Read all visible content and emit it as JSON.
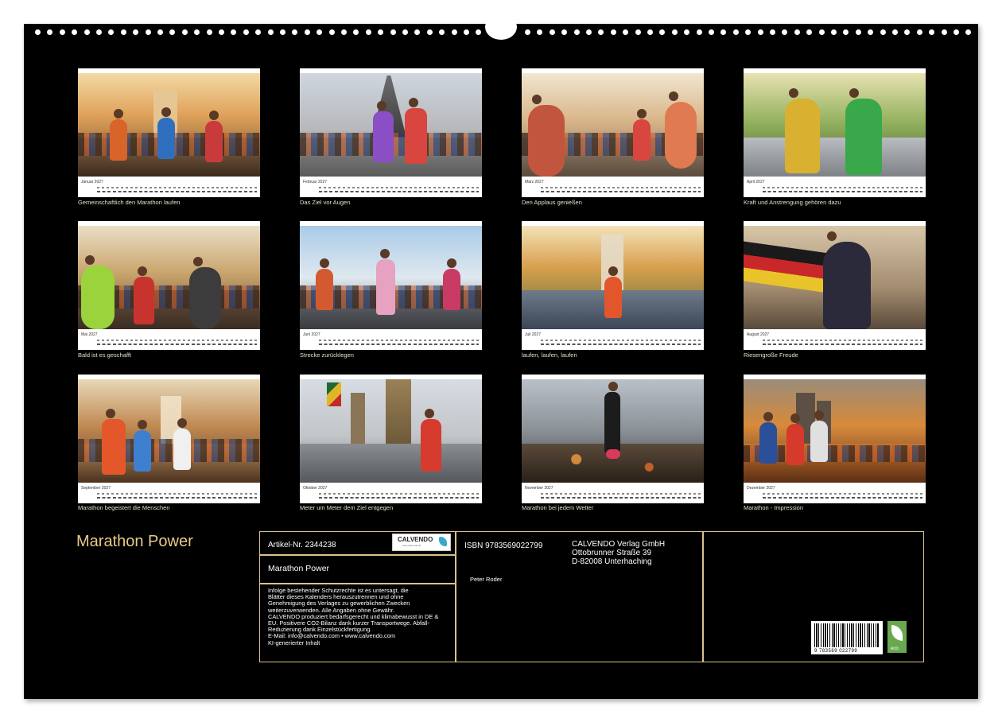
{
  "title": "Marathon Power",
  "months": [
    {
      "label": "Januar 2027",
      "caption": "Gemeinschaftlich den Marathon laufen"
    },
    {
      "label": "Februar 2027",
      "caption": "Das Ziel vor Augen"
    },
    {
      "label": "März 2027",
      "caption": "Den Applaus genießen"
    },
    {
      "label": "April 2027",
      "caption": "Kraft und Anstrengung gehören dazu"
    },
    {
      "label": "Mai 2027",
      "caption": "Bald ist es geschafft"
    },
    {
      "label": "Juni 2027",
      "caption": "Strecke zurücklegen"
    },
    {
      "label": "Juli 2027",
      "caption": "laufen, laufen, laufen"
    },
    {
      "label": "August 2027",
      "caption": "Riesengroße Freude"
    },
    {
      "label": "September 2027",
      "caption": "Marathon begeistert die Menschen"
    },
    {
      "label": "Oktober 2027",
      "caption": "Meter um Meter dem Ziel entgegen"
    },
    {
      "label": "November 2027",
      "caption": "Marathon bei jedem Wetter"
    },
    {
      "label": "Dezember 2027",
      "caption": "Marathon - Impression"
    }
  ],
  "info": {
    "article": "Artikel-Nr. 2344238",
    "logo": "CALVENDO",
    "logo_sub": "www.calvendo.de",
    "product_title": "Marathon Power",
    "legal": [
      "Infolge bestehender Schutzrechte ist es untersagt, die",
      "Blätter dieses Kalenders herauszutrennen und ohne",
      "Genehmigung des Verlages zu gewerblichen Zwecken",
      "weiterzuverwenden. Alle Angaben ohne Gewähr.",
      "CALVENDO produziert bedarfsgerecht und klimabewusst in DE &",
      "EU. Positivere CO2-Bilanz dank kurzer Transportwege. Abfall-",
      "Reduzierung dank Einzelstückfertigung.",
      "E-Mail: info@calvendo.com • www.calvendo.com",
      "KI-generierter Inhalt"
    ],
    "isbn": "ISBN 9783569022799",
    "publisher": [
      "CALVENDO Verlag GmbH",
      "Ottobrunner Straße 39",
      "D-82008 Unterhaching"
    ],
    "author": "Peter Roder",
    "barcode_number": "9 783569 022799",
    "eco_label": "eco"
  }
}
